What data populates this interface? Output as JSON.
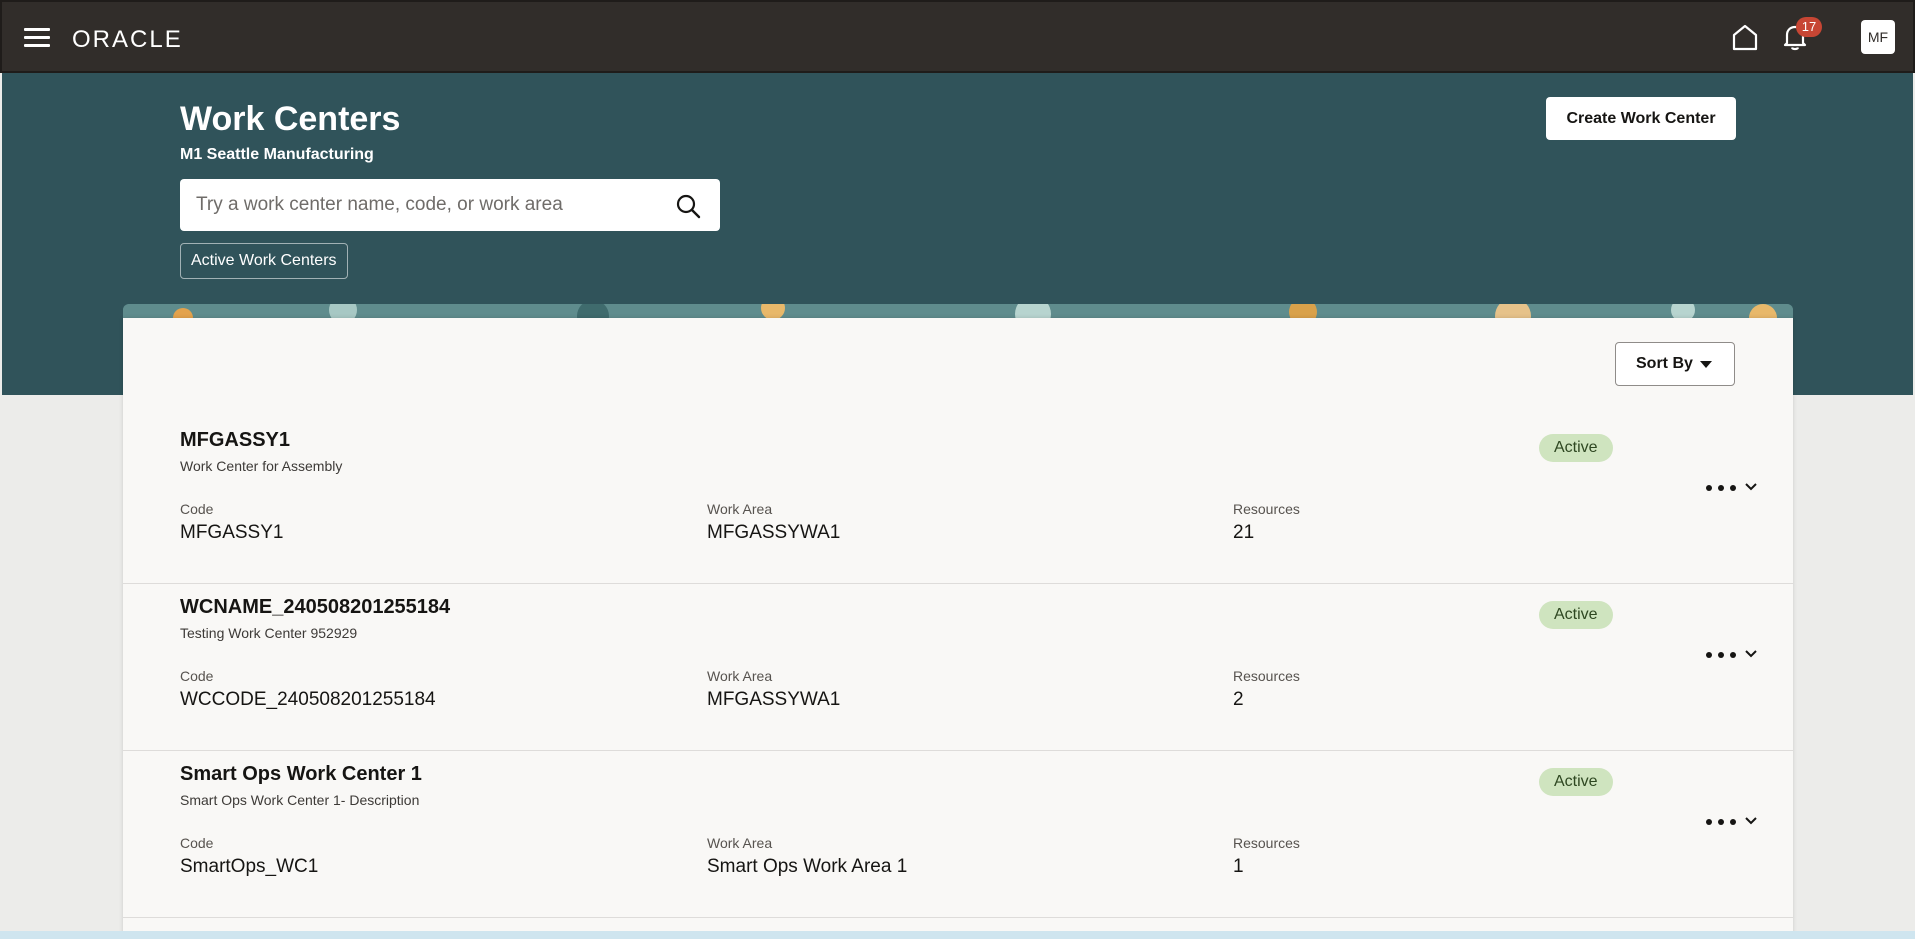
{
  "header": {
    "logo_text": "ORACLE",
    "notification_count": "17",
    "user_initials": "MF"
  },
  "page": {
    "title": "Work Centers",
    "subtitle": "M1 Seattle Manufacturing",
    "search_placeholder": "Try a work center name, code, or work area",
    "filter_chip": "Active Work Centers",
    "create_button": "Create Work Center",
    "sort_button": "Sort By"
  },
  "labels": {
    "code": "Code",
    "work_area": "Work Area",
    "resources": "Resources"
  },
  "work_centers": [
    {
      "name": "MFGASSY1",
      "description": "Work Center for Assembly",
      "code": "MFGASSY1",
      "work_area": "MFGASSYWA1",
      "resources": "21",
      "status": "Active"
    },
    {
      "name": "WCNAME_240508201255184",
      "description": "Testing Work Center 952929",
      "code": "WCCODE_240508201255184",
      "work_area": "MFGASSYWA1",
      "resources": "2",
      "status": "Active"
    },
    {
      "name": "Smart Ops Work Center 1",
      "description": "Smart Ops Work Center 1- Description",
      "code": "SmartOps_WC1",
      "work_area": "Smart Ops Work Area 1",
      "resources": "1",
      "status": "Active"
    }
  ],
  "colors": {
    "topbar": "#312d2a",
    "hero": "#30535a",
    "status_bg": "#cfe4bf",
    "badge": "#c74634"
  },
  "icons": [
    "hamburger-menu-icon",
    "home-icon",
    "bell-icon",
    "search-icon",
    "more-actions-icon",
    "chevron-down-icon"
  ]
}
